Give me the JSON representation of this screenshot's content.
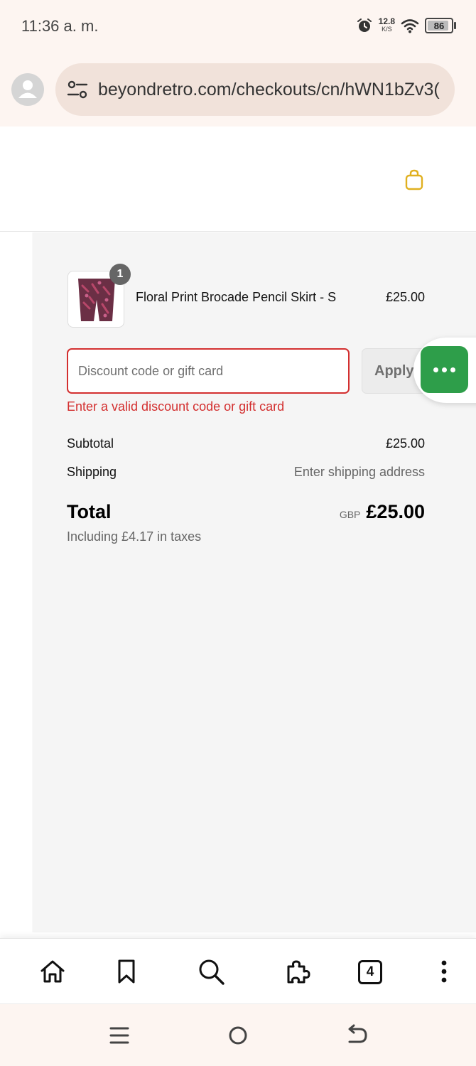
{
  "status_bar": {
    "time": "11:36 a. m.",
    "speed_value": "12.8",
    "speed_unit": "K/S",
    "battery": "86"
  },
  "browser": {
    "url": "beyondretro.com/checkouts/cn/hWN1bZv3("
  },
  "order": {
    "item": {
      "name": "Floral Print Brocade Pencil Skirt - S",
      "price": "£25.00",
      "quantity": "1"
    },
    "discount": {
      "placeholder": "Discount code or gift card",
      "value": "",
      "apply_label": "Apply",
      "error": "Enter a valid discount code or gift card"
    },
    "subtotal_label": "Subtotal",
    "subtotal_value": "£25.00",
    "shipping_label": "Shipping",
    "shipping_value": "Enter shipping address",
    "total_label": "Total",
    "currency": "GBP",
    "total_value": "£25.00",
    "taxes_note": "Including £4.17 in taxes"
  },
  "toolbar": {
    "tab_count": "4",
    "icons": [
      "home-icon",
      "bookmark-icon",
      "search-icon",
      "extensions-icon",
      "tabs-icon",
      "more-icon"
    ]
  },
  "colors": {
    "error": "#d32f2f",
    "chat_green": "#2e9e4a",
    "bag_gold": "#e0b020"
  }
}
